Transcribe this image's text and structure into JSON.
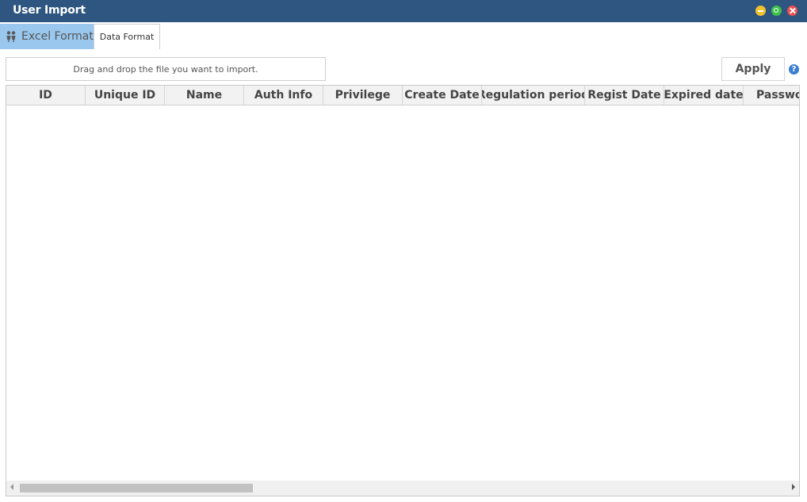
{
  "window": {
    "title": "User Import"
  },
  "tabs": [
    {
      "label": "Excel Format",
      "active": true
    },
    {
      "label": "Data Format",
      "active": false
    }
  ],
  "dropzone": {
    "text": "Drag and drop the file you want to import."
  },
  "toolbar": {
    "apply_label": "Apply",
    "help_glyph": "?"
  },
  "grid": {
    "columns": [
      "ID",
      "Unique ID",
      "Name",
      "Auth Info",
      "Privilege",
      "Create Date",
      "Regulation period",
      "Regist Date",
      "Expired date",
      "Password"
    ],
    "rows": []
  },
  "colors": {
    "titlebar": "#2e5680",
    "active_tab": "#99c7ee",
    "help": "#3b7fd1"
  }
}
